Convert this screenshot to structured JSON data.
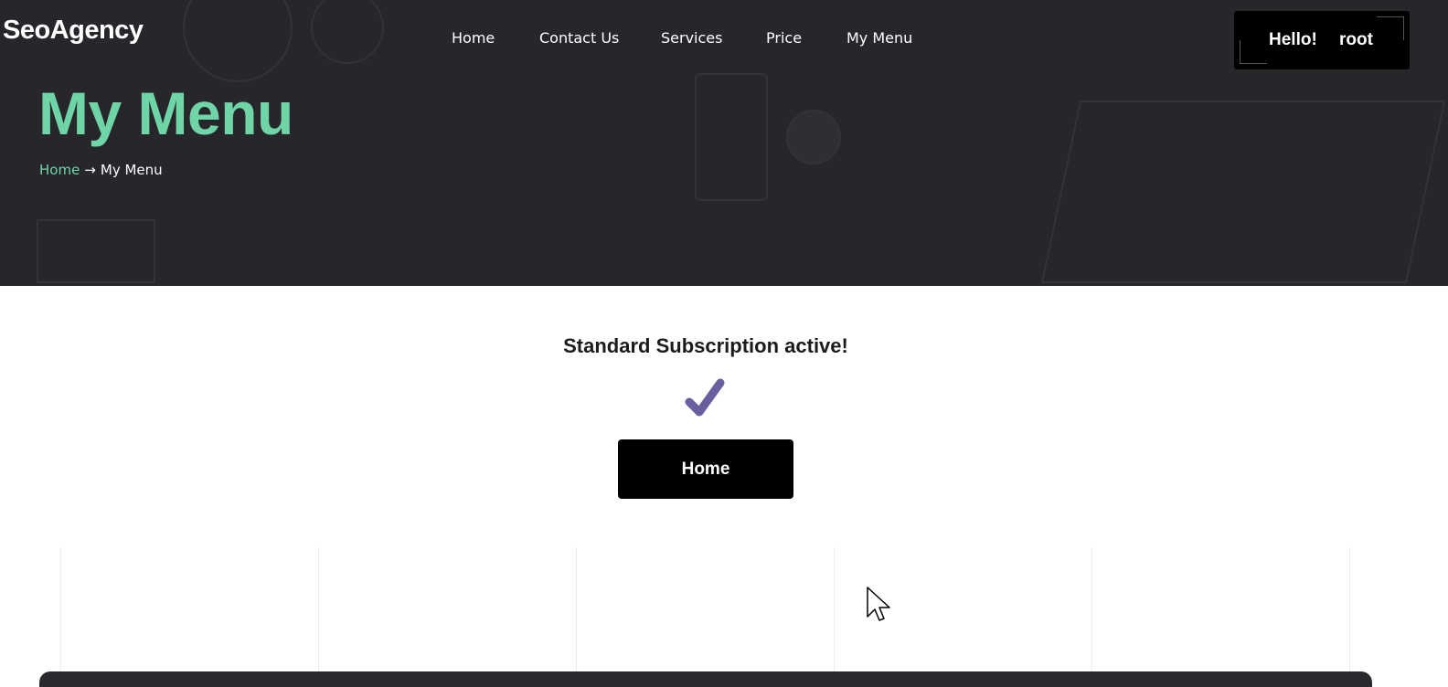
{
  "header": {
    "logo": "SeoAgency",
    "nav": [
      {
        "label": "Home"
      },
      {
        "label": "Contact Us"
      },
      {
        "label": "Services"
      },
      {
        "label": "Price"
      },
      {
        "label": "My Menu"
      }
    ],
    "greeting": "Hello!",
    "username": "root"
  },
  "hero": {
    "title": "My Menu",
    "breadcrumb": {
      "home": "Home",
      "separator": "→",
      "current": "My Menu"
    }
  },
  "main": {
    "status_message": "Standard Subscription active!",
    "status_icon": "check-icon",
    "home_button_label": "Home"
  },
  "colors": {
    "accent_green": "#6fd4a6",
    "check_purple": "#6a5f9e",
    "hero_bg": "#26262b",
    "button_bg": "#000000"
  }
}
